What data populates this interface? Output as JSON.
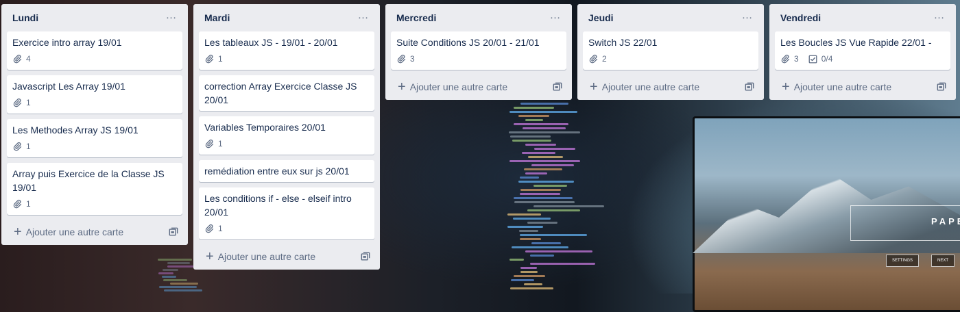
{
  "background": {
    "photo_text": "PAPE",
    "photo_buttons": [
      "SETTINGS",
      "NEXT"
    ]
  },
  "add_card_label": "Ajouter une autre carte",
  "lists": [
    {
      "title": "Lundi",
      "cards": [
        {
          "title": "Exercice intro array 19/01",
          "attachments": "4"
        },
        {
          "title": "Javascript Les Array 19/01",
          "attachments": "1"
        },
        {
          "title": "Les Methodes Array JS 19/01",
          "attachments": "1"
        },
        {
          "title": "Array puis Exercice de la Classe JS 19/01",
          "attachments": "1"
        }
      ]
    },
    {
      "title": "Mardi",
      "cards": [
        {
          "title": "Les tableaux JS - 19/01 - 20/01",
          "attachments": "1"
        },
        {
          "title": "correction Array Exercice Classe JS 20/01"
        },
        {
          "title": "Variables Temporaires 20/01",
          "attachments": "1"
        },
        {
          "title": "remédiation entre eux sur js 20/01"
        },
        {
          "title": "Les conditions if - else - elseif intro 20/01",
          "attachments": "1"
        }
      ]
    },
    {
      "title": "Mercredi",
      "cards": [
        {
          "title": "Suite Conditions JS 20/01 - 21/01",
          "attachments": "3"
        }
      ]
    },
    {
      "title": "Jeudi",
      "cards": [
        {
          "title": "Switch JS 22/01",
          "attachments": "2"
        }
      ]
    },
    {
      "title": "Vendredi",
      "cards": [
        {
          "title": "Les Boucles JS Vue Rapide 22/01 -",
          "attachments": "3",
          "checklist": "0/4"
        }
      ]
    }
  ]
}
